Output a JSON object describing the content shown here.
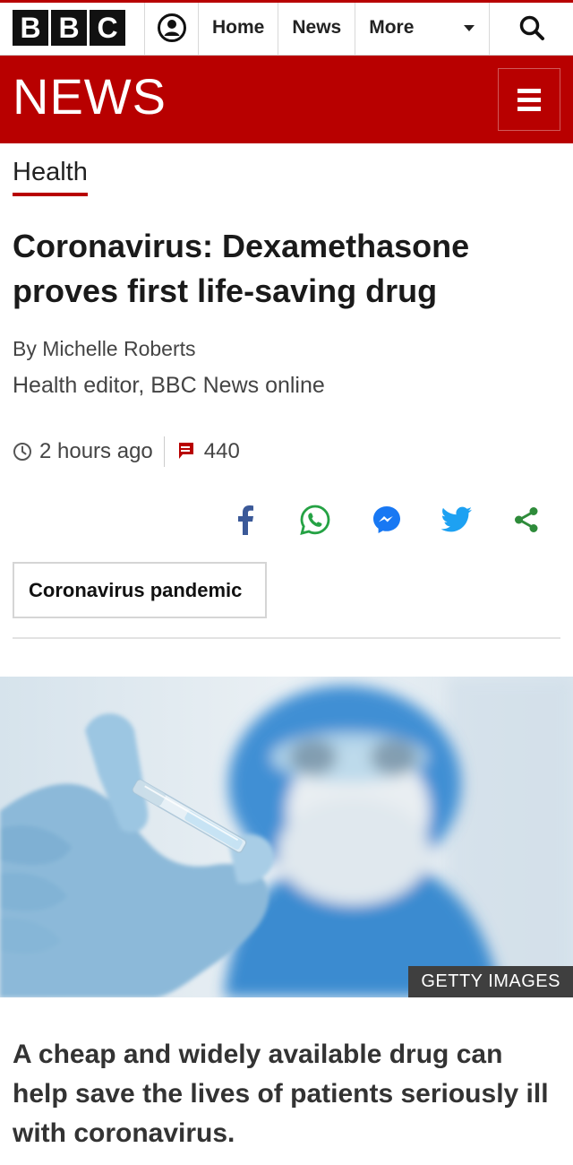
{
  "topbar": {
    "logo_letters": [
      "B",
      "B",
      "C"
    ],
    "account_icon": "account-icon",
    "nav": [
      "Home",
      "News",
      "More"
    ],
    "more_icon": "caret-down-icon",
    "search_icon": "search-icon"
  },
  "masthead": {
    "title": "NEWS",
    "menu_icon": "hamburger-menu-icon",
    "color": "#b80000"
  },
  "article": {
    "section": "Health",
    "headline_line1": "Coronavirus: Dexamethasone",
    "headline_line2": "proves first life-saving drug",
    "author": "By Michelle Roberts",
    "author_role": "Health editor, BBC News online",
    "time": "2 hours ago",
    "comments": "440",
    "share_icons": [
      "facebook-icon",
      "whatsapp-icon",
      "messenger-icon",
      "twitter-icon",
      "share-icon"
    ],
    "topic_tag": "Coronavirus pandemic",
    "image_credit": "GETTY IMAGES",
    "lede": "A cheap and widely available drug can help save the lives of patients seriously ill with coronavirus."
  },
  "colors": {
    "brand_red": "#b80000",
    "facebook": "#3b5998",
    "whatsapp": "#25a244",
    "messenger": "#1878f3",
    "twitter": "#1da1f2",
    "share": "#2e8b3a"
  }
}
